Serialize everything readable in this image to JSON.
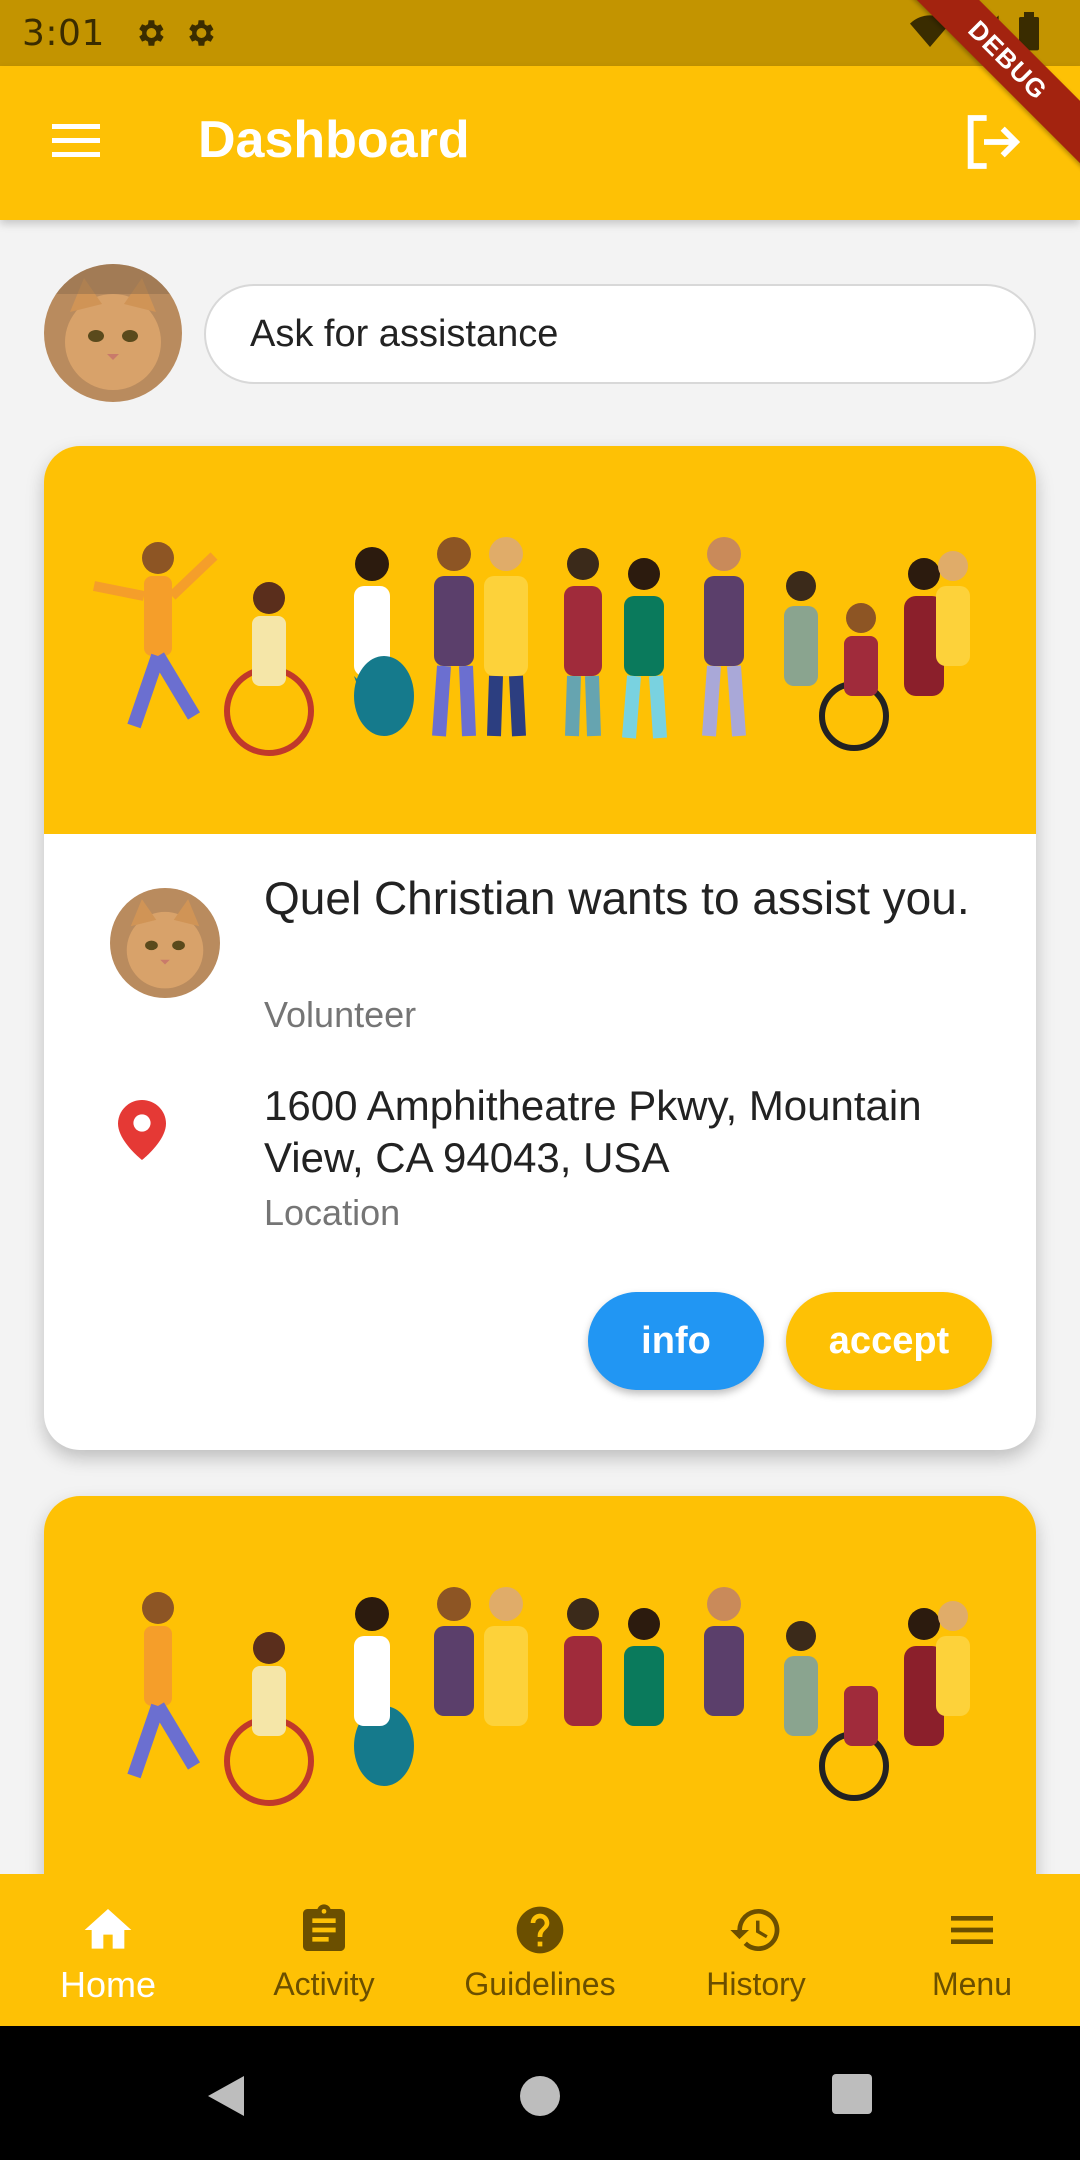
{
  "status_bar": {
    "time": "3:01"
  },
  "debug_label": "DEBUG",
  "app_bar": {
    "title": "Dashboard"
  },
  "ask": {
    "placeholder": "Ask for assistance"
  },
  "cards": [
    {
      "title": "Quel Christian wants to assist you.",
      "role": "Volunteer",
      "address": "1600 Amphitheatre Pkwy, Mountain View, CA 94043, USA",
      "address_label": "Location",
      "info_label": "info",
      "accept_label": "accept"
    }
  ],
  "bottom_nav": {
    "items": [
      {
        "label": "Home",
        "icon": "home-icon",
        "active": true
      },
      {
        "label": "Activity",
        "icon": "clipboard-icon",
        "active": false
      },
      {
        "label": "Guidelines",
        "icon": "help-icon",
        "active": false
      },
      {
        "label": "History",
        "icon": "history-icon",
        "active": false
      },
      {
        "label": "Menu",
        "icon": "menu-icon",
        "active": false
      }
    ]
  },
  "colors": {
    "primary": "#fec105",
    "status_bar": "#c39400",
    "info_button": "#2196f3",
    "pin": "#e53935"
  }
}
